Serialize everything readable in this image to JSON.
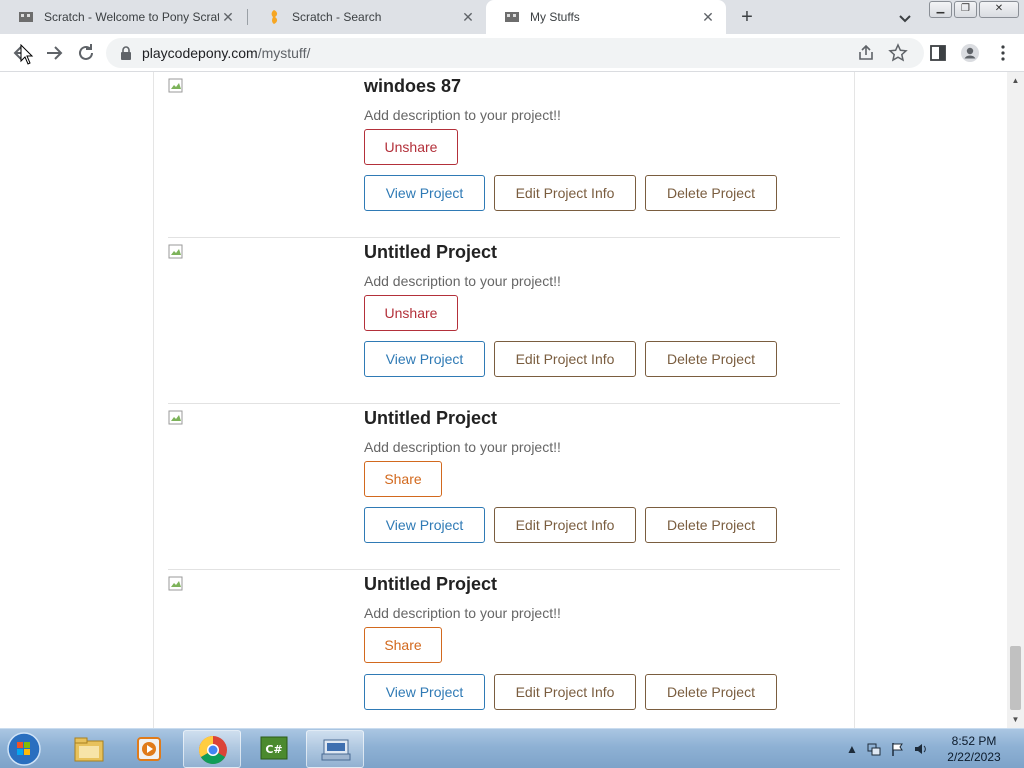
{
  "browser": {
    "tabs": [
      {
        "title": "Scratch - Welcome to Pony Scrat",
        "favicon": "pony-favicon",
        "active": false
      },
      {
        "title": "Scratch - Search",
        "favicon": "scratch-favicon",
        "active": false
      },
      {
        "title": "My Stuffs",
        "favicon": "pony-favicon",
        "active": true
      }
    ],
    "url_host": "playcodepony.com",
    "url_path": "/mystuff/"
  },
  "projects": [
    {
      "title": "windoes 87",
      "description": "Add description to your project!!",
      "share_label": "Unshare",
      "shared": true,
      "view_label": "View Project",
      "edit_label": "Edit Project Info",
      "delete_label": "Delete Project"
    },
    {
      "title": "Untitled Project",
      "description": "Add description to your project!!",
      "share_label": "Unshare",
      "shared": true,
      "view_label": "View Project",
      "edit_label": "Edit Project Info",
      "delete_label": "Delete Project"
    },
    {
      "title": "Untitled Project",
      "description": "Add description to your project!!",
      "share_label": "Share",
      "shared": false,
      "view_label": "View Project",
      "edit_label": "Edit Project Info",
      "delete_label": "Delete Project"
    },
    {
      "title": "Untitled Project",
      "description": "Add description to your project!!",
      "share_label": "Share",
      "shared": false,
      "view_label": "View Project",
      "edit_label": "Edit Project Info",
      "delete_label": "Delete Project"
    }
  ],
  "taskbar": {
    "apps": [
      "windows-explorer-icon",
      "media-player-icon",
      "chrome-icon",
      "csharp-editor-icon",
      "keyboard-app-icon"
    ],
    "time": "8:52 PM",
    "date": "2/22/2023"
  },
  "colors": {
    "unshare": "#b3303a",
    "share": "#d2691e",
    "view": "#2f7ab5",
    "edit_delete": "#7a5d3f"
  }
}
